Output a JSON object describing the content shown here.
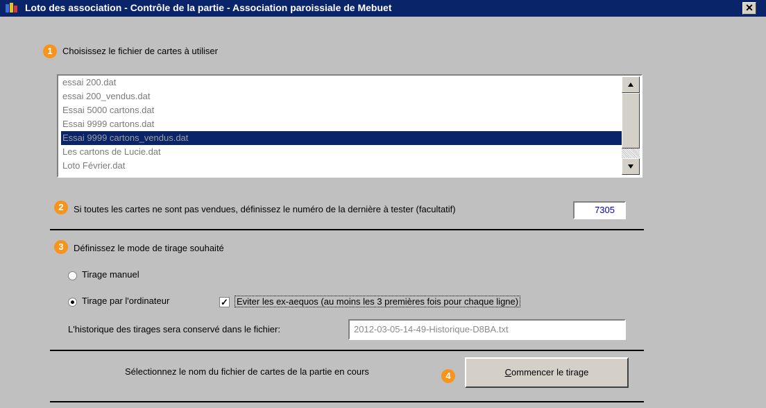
{
  "window": {
    "title": "Loto des association - Contrôle de la partie - Association paroissiale de Mebuet",
    "close_glyph": "✕"
  },
  "step1": {
    "badge": "1",
    "label": "Choisissez le fichier de cartes à utiliser",
    "files": [
      "essai 200.dat",
      "essai 200_vendus.dat",
      "Essai 5000 cartons.dat",
      "Essai 9999 cartons.dat",
      "Essai 9999 cartons_vendus.dat",
      "Les cartons de Lucie.dat",
      "Loto Février.dat"
    ],
    "selected": "Essai 9999 cartons_vendus.dat"
  },
  "step2": {
    "badge": "2",
    "label": "Si toutes les cartes ne sont pas vendues, définissez le numéro de la dernière à tester (facultatif)",
    "value": "7305"
  },
  "step3": {
    "badge": "3",
    "label": "Définissez le mode de tirage souhaité",
    "radio_manual": "Tirage manuel",
    "radio_computer": "Tirage par l'ordinateur",
    "selected_mode": "Tirage par l'ordinateur",
    "checkbox_label": "Eviter les ex-aequos (au moins les 3 premières fois pour chaque ligne)",
    "checkbox_checked": true,
    "history_label": "L'historique des tirages sera conservé dans le fichier:",
    "history_file": "2012-03-05-14-49-Historique-D8BA.txt"
  },
  "step4": {
    "badge": "4",
    "label": "Sélectionnez le nom du fichier de cartes de la partie en cours",
    "button_label_first": "C",
    "button_label_rest": "ommencer le tirage"
  },
  "colors": {
    "title_bar": "#0a246a",
    "badge": "#f7941d",
    "window_bg": "#c0c0c0",
    "number_text": "#0000c0"
  }
}
